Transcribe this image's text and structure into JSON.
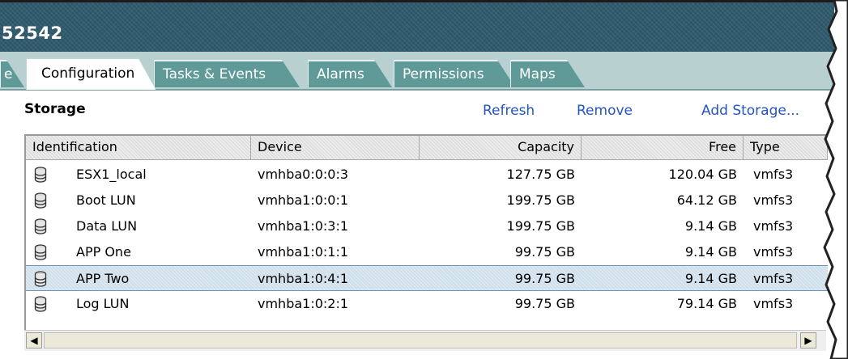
{
  "window": {
    "title": "52542"
  },
  "tabs": [
    {
      "label": "e"
    },
    {
      "label": "Configuration"
    },
    {
      "label": "Tasks & Events"
    },
    {
      "label": "Alarms"
    },
    {
      "label": "Permissions"
    },
    {
      "label": "Maps"
    }
  ],
  "active_tab": "Configuration",
  "section": {
    "title": "Storage"
  },
  "actions": {
    "refresh": "Refresh",
    "remove": "Remove",
    "add_storage": "Add Storage..."
  },
  "table": {
    "headers": [
      "Identification",
      "Device",
      "Capacity",
      "Free",
      "Type"
    ],
    "rows": [
      {
        "identification": "ESX1_local",
        "device": "vmhba0:0:0:3",
        "capacity": "127.75 GB",
        "free": "120.04 GB",
        "type": "vmfs3",
        "icon": "datastore-icon"
      },
      {
        "identification": "Boot LUN",
        "device": "vmhba1:0:0:1",
        "capacity": "199.75 GB",
        "free": "64.12 GB",
        "type": "vmfs3",
        "icon": "datastore-icon"
      },
      {
        "identification": "Data LUN",
        "device": "vmhba1:0:3:1",
        "capacity": "199.75 GB",
        "free": "9.14 GB",
        "type": "vmfs3",
        "icon": "datastore-icon"
      },
      {
        "identification": "APP One",
        "device": "vmhba1:0:1:1",
        "capacity": "99.75 GB",
        "free": "9.14 GB",
        "type": "vmfs3",
        "icon": "datastore-icon"
      },
      {
        "identification": "APP Two",
        "device": "vmhba1:0:4:1",
        "capacity": "99.75 GB",
        "free": "9.14 GB",
        "type": "vmfs3",
        "icon": "datastore-icon",
        "selected": true
      },
      {
        "identification": "Log LUN",
        "device": "vmhba1:0:2:1",
        "capacity": "99.75 GB",
        "free": "79.14 GB",
        "type": "vmfs3",
        "icon": "datastore-icon"
      }
    ]
  },
  "colors": {
    "title_bar": "#2f5a6e",
    "tab_strip": "#b8d0cf",
    "tab": "#5f9a98",
    "link": "#2354c0",
    "selection": "#cfe0ec"
  }
}
